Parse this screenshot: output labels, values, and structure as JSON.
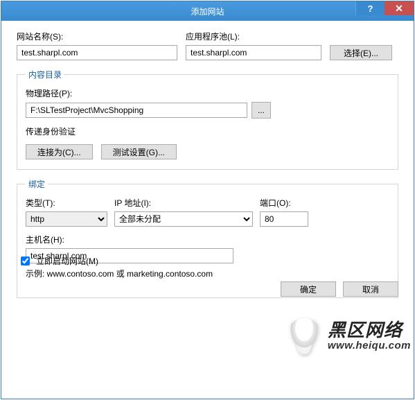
{
  "window": {
    "title": "添加网站",
    "help": "?",
    "close": "✕"
  },
  "siteName": {
    "label": "网站名称(S):",
    "value": "test.sharpl.com"
  },
  "appPool": {
    "label": "应用程序池(L):",
    "value": "test.sharpl.com",
    "selectBtn": "选择(E)..."
  },
  "contentDir": {
    "legend": "内容目录",
    "pathLabel": "物理路径(P):",
    "pathValue": "F:\\SLTestProject\\MvcShopping",
    "browse": "...",
    "passthru": "传递身份验证",
    "connectAs": "连接为(C)...",
    "testSettings": "测试设置(G)..."
  },
  "binding": {
    "legend": "绑定",
    "typeLabel": "类型(T):",
    "typeValue": "http",
    "ipLabel": "IP 地址(I):",
    "ipValue": "全部未分配",
    "portLabel": "端口(O):",
    "portValue": "80",
    "hostLabel": "主机名(H):",
    "hostValue": "test.sharpl.com",
    "example": "示例: www.contoso.com 或 marketing.contoso.com"
  },
  "startNow": {
    "label": "立即启动网站(M)",
    "checked": true
  },
  "footer": {
    "ok": "确定",
    "cancel": "取消"
  },
  "watermark": {
    "text": "黑区网络",
    "url": "www.heiqu.com"
  }
}
